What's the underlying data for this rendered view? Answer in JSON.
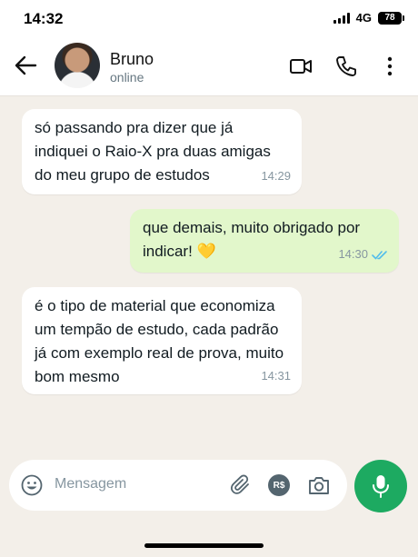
{
  "status_bar": {
    "time": "14:32",
    "network": "4G",
    "battery": "78"
  },
  "contact": {
    "name": "Bruno",
    "status": "online"
  },
  "messages": [
    {
      "direction": "incoming",
      "text": "só passando pra dizer que já indiquei o Raio-X pra duas amigas do meu grupo de estudos",
      "time": "14:29"
    },
    {
      "direction": "outgoing",
      "text": "que demais, muito obrigado por indicar! 💛",
      "time": "14:30",
      "read": true
    },
    {
      "direction": "incoming",
      "text": "é o tipo de material que economiza um tempão de estudo, cada padrão já com exemplo real de prova, muito bom mesmo",
      "time": "14:31"
    }
  ],
  "composer": {
    "placeholder": "Mensagem",
    "currency_label": "R$"
  },
  "colors": {
    "accent": "#1daa61",
    "outgoing_bubble": "#e2f7cb",
    "read_ticks": "#53bdeb"
  }
}
